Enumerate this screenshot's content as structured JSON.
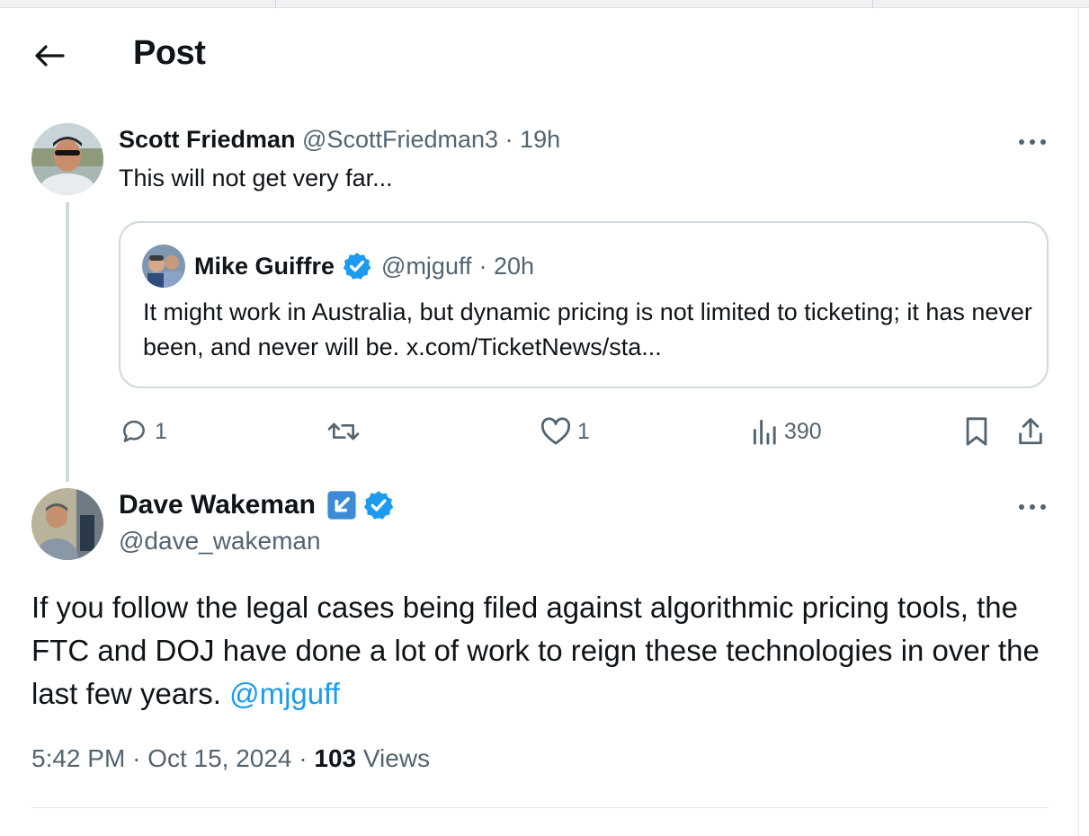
{
  "header": {
    "title": "Post"
  },
  "reply_post": {
    "author_name": "Scott Friedman",
    "handle": "@ScottFriedman3",
    "time": "· 19h",
    "text": "This will not get very far...",
    "quote": {
      "author_name": "Mike Guiffre",
      "handle": "@mjguff",
      "time": "· 20h",
      "text": "It might work in Australia, but dynamic pricing is not limited to ticketing; it has never been, and never will be. x.com/TicketNews/sta..."
    },
    "stats": {
      "replies": "1",
      "likes": "1",
      "views": "390"
    }
  },
  "main_post": {
    "author_name": "Dave Wakeman",
    "handle": "@dave_wakeman",
    "text": "If you follow the legal cases being filed against algorithmic pricing tools, the FTC and DOJ have done a lot of work to reign these technologies in over the last few years.",
    "mention": "@mjguff",
    "time": "5:42 PM",
    "date": "· Oct 15, 2024 ·",
    "views_count": "103",
    "views_label": "Views"
  },
  "colors": {
    "accent": "#1d9bf0",
    "text": "#0f1419",
    "muted": "#536471",
    "border": "#cfd9de"
  },
  "icons": [
    "back-arrow-icon",
    "more-icon",
    "verified-badge-icon",
    "reply-icon",
    "repost-icon",
    "like-icon",
    "views-icon",
    "bookmark-icon",
    "share-icon",
    "affiliate-badge-icon"
  ]
}
